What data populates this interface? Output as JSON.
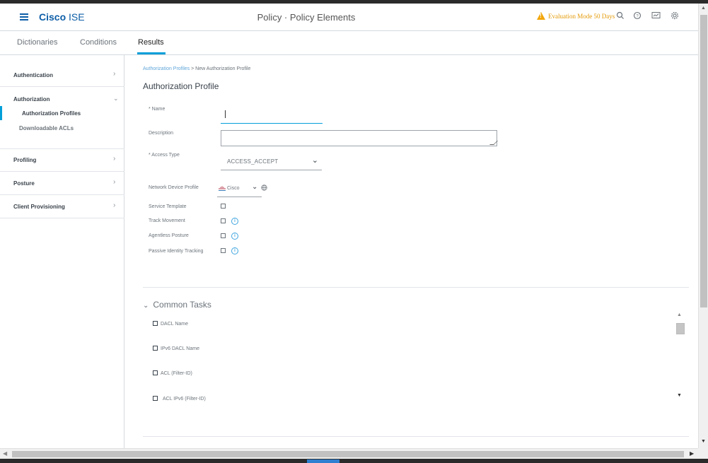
{
  "header": {
    "brand_bold": "Cisco",
    "brand_rest": " ISE",
    "title": "Policy · Policy Elements",
    "eval_badge": "Evaluation Mode 50 Days",
    "icons": [
      "search-icon",
      "help-icon",
      "dashboard-icon",
      "settings-icon"
    ]
  },
  "tabs": [
    {
      "label": "Dictionaries",
      "active": false
    },
    {
      "label": "Conditions",
      "active": false
    },
    {
      "label": "Results",
      "active": true
    }
  ],
  "sidebar": {
    "sections": [
      {
        "label": "Authentication",
        "expanded": false
      },
      {
        "label": "Authorization",
        "expanded": true,
        "items": [
          "Authorization Profiles",
          "Downloadable ACLs"
        ]
      },
      {
        "label": "Profiling",
        "expanded": false
      },
      {
        "label": "Posture",
        "expanded": false
      },
      {
        "label": "Client Provisioning",
        "expanded": false
      }
    ],
    "active_item": "Authorization Profiles"
  },
  "breadcrumb": {
    "parent": "Authorization Profiles",
    "separator": ">",
    "current": "New Authorization Profile"
  },
  "page_title": "Authorization Profile",
  "form": {
    "name_label": "* Name",
    "name_value": "",
    "description_label": "Description",
    "description_value": "",
    "access_type_label": "* Access Type",
    "access_type_value": "ACCESS_ACCEPT",
    "ndp_label": "Network Device Profile",
    "ndp_value": "Cisco",
    "service_template_label": "Service Template",
    "track_movement_label": "Track Movement",
    "agentless_posture_label": "Agentless Posture",
    "passive_identity_label": "Passive Identity Tracking",
    "info_glyph": "i"
  },
  "common_tasks": {
    "title": "Common Tasks",
    "items": [
      "DACL Name",
      "IPv6 DACL Name",
      "ACL  (Filter-ID)",
      "ACL IPv6 (Filter-ID)"
    ]
  },
  "colors": {
    "accent": "#049fd9",
    "brand": "#0d5ea8",
    "warning": "#f2a60c"
  }
}
